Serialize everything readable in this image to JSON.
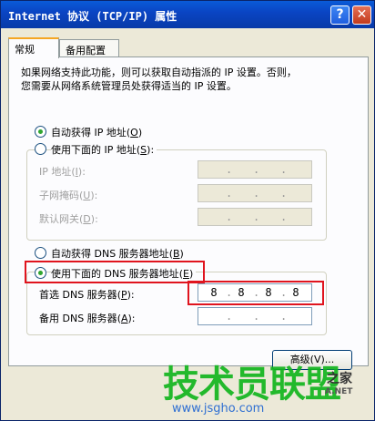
{
  "window": {
    "title": "Internet 协议 (TCP/IP) 属性",
    "help_symbol": "?",
    "close_symbol": "✕"
  },
  "tabs": [
    {
      "label": "常规"
    },
    {
      "label": "备用配置"
    }
  ],
  "description": "如果网络支持此功能，则可以获取自动指派的 IP 设置。否则，\n您需要从网络系统管理员处获得适当的 IP 设置。",
  "ip_section": {
    "auto_label": "自动获得 IP 地址",
    "auto_key": "O",
    "manual_label": "使用下面的 IP 地址",
    "manual_key": "S",
    "fields": [
      {
        "label": "IP 地址",
        "key": "I"
      },
      {
        "label": "子网掩码",
        "key": "U"
      },
      {
        "label": "默认网关",
        "key": "D"
      }
    ]
  },
  "dns_section": {
    "auto_label": "自动获得 DNS 服务器地址",
    "auto_key": "B",
    "manual_label": "使用下面的 DNS 服务器地址",
    "manual_key": "E",
    "preferred_label": "首选 DNS 服务器",
    "preferred_key": "P",
    "preferred_value": [
      "8",
      "8",
      "8",
      "8"
    ],
    "alternate_label": "备用 DNS 服务器",
    "alternate_key": "A"
  },
  "buttons": {
    "advanced": "高级(V)..."
  },
  "watermark": {
    "main": "技术员联盟",
    "side": "之家",
    "url_side": "A.NET",
    "url": "www.jsgho.com"
  },
  "colors": {
    "highlight": "#e0141e",
    "title_bar": "#0a45c4",
    "radio_dot": "#2fa52f"
  }
}
